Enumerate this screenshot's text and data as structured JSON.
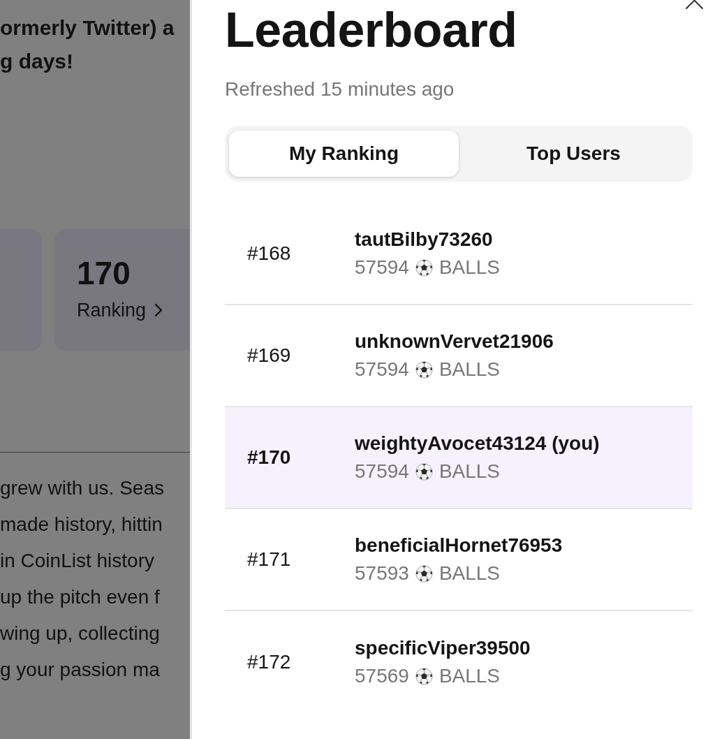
{
  "background_page": {
    "intro_lines": [
      "ormerly Twitter) a",
      "g days!"
    ],
    "ranking_card": {
      "value": "170",
      "label": "Ranking"
    },
    "story_lines": [
      "grew with us. Seas",
      "made history, hittin",
      "in CoinList history",
      "up the pitch even f",
      "wing up, collecting",
      "g your passion ma"
    ]
  },
  "drawer": {
    "title": "Leaderboard",
    "refreshed": "Refreshed 15 minutes ago",
    "tabs": [
      {
        "label": "My Ranking",
        "selected": true
      },
      {
        "label": "Top Users",
        "selected": false
      }
    ],
    "rows": [
      {
        "rank": "#168",
        "name": "tautBilby73260",
        "points": "57594",
        "unit": "BALLS",
        "highlighted": false
      },
      {
        "rank": "#169",
        "name": "unknownVervet21906",
        "points": "57594",
        "unit": "BALLS",
        "highlighted": false
      },
      {
        "rank": "#170",
        "name": "weightyAvocet43124 (you)",
        "points": "57594",
        "unit": "BALLS",
        "highlighted": true
      },
      {
        "rank": "#171",
        "name": "beneficialHornet76953",
        "points": "57593",
        "unit": "BALLS",
        "highlighted": false
      },
      {
        "rank": "#172",
        "name": "specificViper39500",
        "points": "57569",
        "unit": "BALLS",
        "highlighted": false
      }
    ]
  }
}
